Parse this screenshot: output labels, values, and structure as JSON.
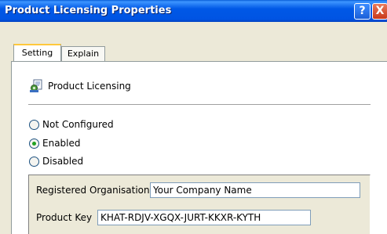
{
  "window": {
    "title": "Product Licensing Properties",
    "help_glyph": "?",
    "close_glyph": "X"
  },
  "tabs": [
    {
      "label": "Setting",
      "active": true
    },
    {
      "label": "Explain",
      "active": false
    }
  ],
  "policy": {
    "icon": "policy-gear-icon",
    "name": "Product Licensing"
  },
  "state_options": [
    {
      "label": "Not Configured",
      "selected": false
    },
    {
      "label": "Enabled",
      "selected": true
    },
    {
      "label": "Disabled",
      "selected": false
    }
  ],
  "options": {
    "org_label": "Registered Organisation",
    "org_value": "Your Company Name",
    "key_label": "Product Key",
    "key_value": "KHAT-RDJV-XGQX-JURT-KKXR-KYTH"
  },
  "colors": {
    "titlebar": "#0054e3",
    "active_tab_accent": "#ffc83c",
    "radio_selected": "#21a121",
    "close_button": "#c8391b"
  }
}
